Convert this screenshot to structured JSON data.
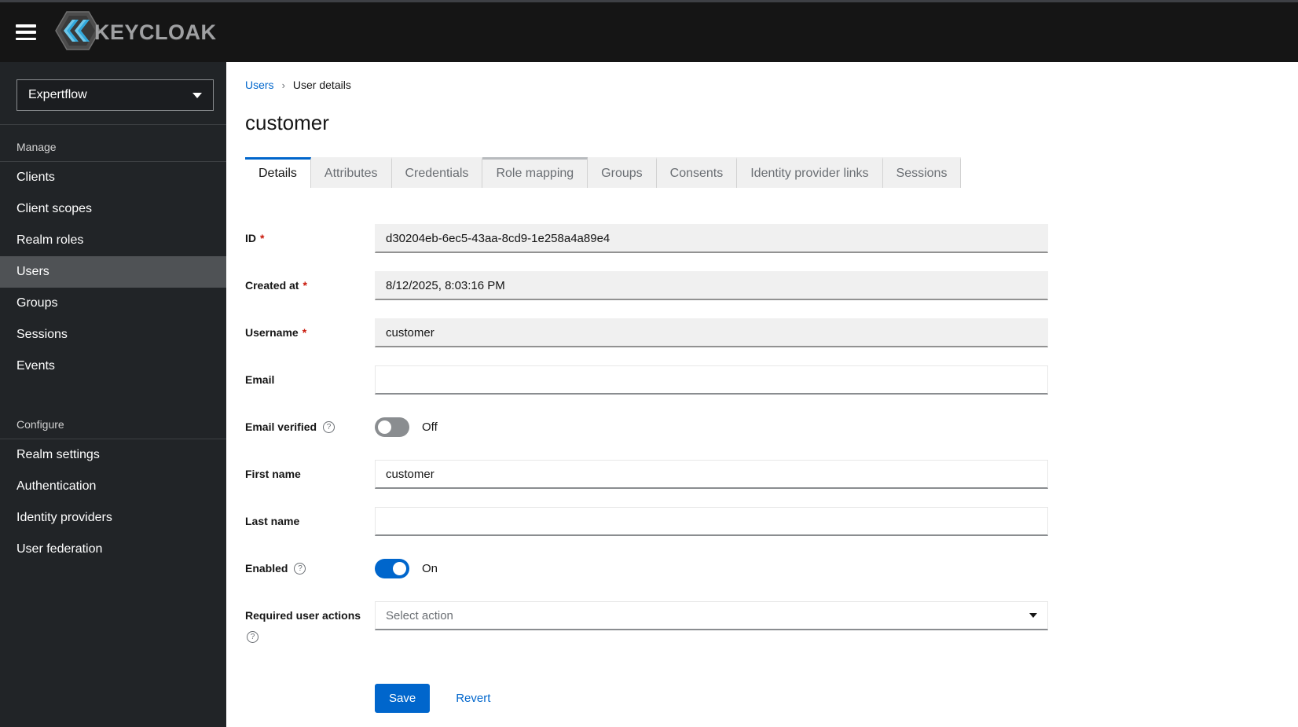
{
  "brand": {
    "name": "KEYCLOAK"
  },
  "sidebar": {
    "realm": "Expertflow",
    "sections": [
      {
        "title": "Manage",
        "items": [
          {
            "label": "Clients"
          },
          {
            "label": "Client scopes"
          },
          {
            "label": "Realm roles"
          },
          {
            "label": "Users"
          },
          {
            "label": "Groups"
          },
          {
            "label": "Sessions"
          },
          {
            "label": "Events"
          }
        ]
      },
      {
        "title": "Configure",
        "items": [
          {
            "label": "Realm settings"
          },
          {
            "label": "Authentication"
          },
          {
            "label": "Identity providers"
          },
          {
            "label": "User federation"
          }
        ]
      }
    ]
  },
  "breadcrumb": {
    "parent": "Users",
    "current": "User details"
  },
  "page_title": "customer",
  "tabs": [
    "Details",
    "Attributes",
    "Credentials",
    "Role mapping",
    "Groups",
    "Consents",
    "Identity provider links",
    "Sessions"
  ],
  "form": {
    "required_mark": "*",
    "id": {
      "label": "ID",
      "value": "d30204eb-6ec5-43aa-8cd9-1e258a4a89e4"
    },
    "created_at": {
      "label": "Created at",
      "value": "8/12/2025, 8:03:16 PM"
    },
    "username": {
      "label": "Username",
      "value": "customer"
    },
    "email": {
      "label": "Email",
      "value": ""
    },
    "email_verified": {
      "label": "Email verified",
      "state": "Off"
    },
    "first_name": {
      "label": "First name",
      "value": "customer"
    },
    "last_name": {
      "label": "Last name",
      "value": ""
    },
    "enabled": {
      "label": "Enabled",
      "state": "On"
    },
    "required_user_actions": {
      "label": "Required user actions",
      "placeholder": "Select action"
    }
  },
  "actions": {
    "save": "Save",
    "revert": "Revert"
  },
  "colors": {
    "accent": "#0066cc",
    "danger": "#c9190b",
    "masthead": "#151515",
    "sidebar": "#212427",
    "active_item": "#4f5255",
    "tab_inactive": "#f0f0f0"
  }
}
